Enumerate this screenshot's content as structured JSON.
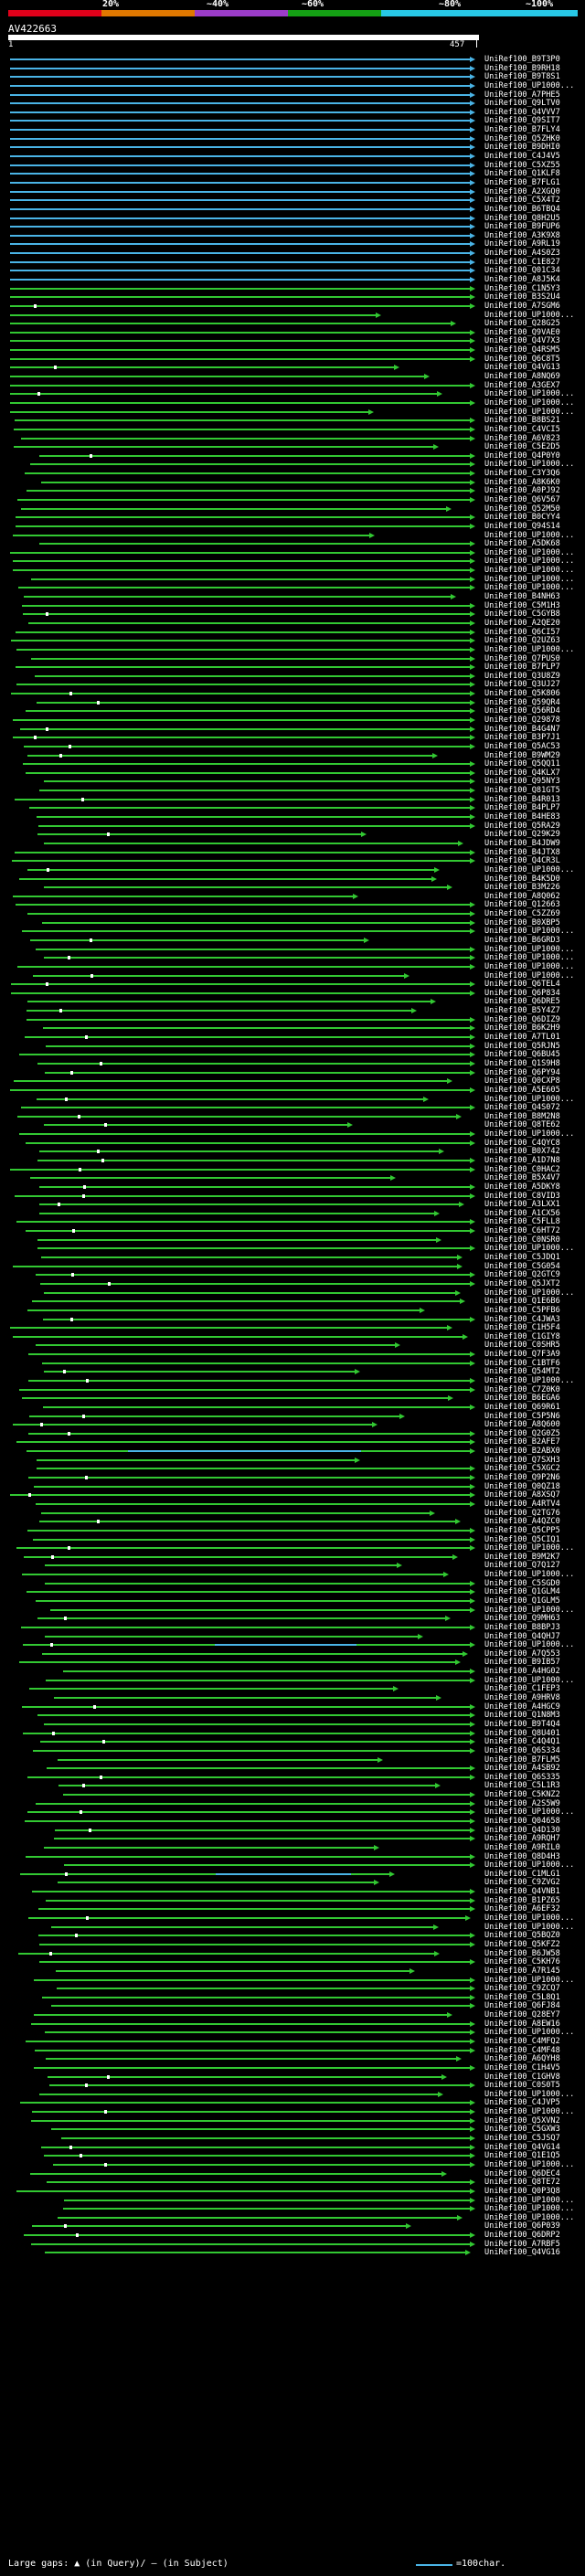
{
  "header": {
    "query_id": "AV422663",
    "query_start": "1",
    "query_end": "457",
    "scale": [
      {
        "label": "20%",
        "color": "#e0001a"
      },
      {
        "label": "~40%",
        "color": "#e07800"
      },
      {
        "label": "~60%",
        "color": "#9b3cc8"
      },
      {
        "label": "~80%",
        "color": "#14a014"
      },
      {
        "label": "~100%",
        "color": "#28c8e6"
      }
    ]
  },
  "hit_colors": {
    "blue": "#4ab4e6",
    "green": "#32c832"
  },
  "hits": [
    "UniRef100_B9T3P0",
    "UniRef100_B9RH18",
    "UniRef100_B9T8S1",
    "UniRef100_UP1000...",
    "UniRef100_A7PHE5",
    "UniRef100_Q9LTV0",
    "UniRef100_Q4VVV7",
    "UniRef100_Q9SIT7",
    "UniRef100_B7FLY4",
    "UniRef100_Q5ZHK0",
    "UniRef100_B9DHI0",
    "UniRef100_C4J4V5",
    "UniRef100_C5XZ55",
    "UniRef100_Q1KLF8",
    "UniRef100_B7FLG1",
    "UniRef100_A2XGQ0",
    "UniRef100_C5X4T2",
    "UniRef100_B6TBQ4",
    "UniRef100_Q8H2U5",
    "UniRef100_B9FUP6",
    "UniRef100_A3K9X8",
    "UniRef100_A9RL19",
    "UniRef100_A4S0Z3",
    "UniRef100_C1E827",
    "UniRef100_Q01C34",
    "UniRef100_A8J5K4",
    "UniRef100_C1N5Y3",
    "UniRef100_B3S2U4",
    "UniRef100_A7SGM6",
    "UniRef100_UP1000...",
    "UniRef100_Q28G25",
    "UniRef100_Q9VAE0",
    "UniRef100_Q4V7X3",
    "UniRef100_Q4RSM5",
    "UniRef100_Q6C8T5",
    "UniRef100_Q4VG13",
    "UniRef100_A8NQ69",
    "UniRef100_A3GEX7",
    "UniRef100_UP1000...",
    "UniRef100_UP1000...",
    "UniRef100_UP1000...",
    "UniRef100_B8BS21",
    "UniRef100_C4VCI5",
    "UniRef100_A6V823",
    "UniRef100_C5E2D5",
    "UniRef100_Q4P0Y0",
    "UniRef100_UP1000...",
    "UniRef100_C3Y3Q6",
    "UniRef100_A8K6K0",
    "UniRef100_A0PJ92",
    "UniRef100_Q6V567",
    "UniRef100_Q52M50",
    "UniRef100_B0CYY4",
    "UniRef100_Q94S14",
    "UniRef100_UP1000...",
    "UniRef100_A5DK68",
    "UniRef100_UP1000...",
    "UniRef100_UP1000...",
    "UniRef100_UP1000...",
    "UniRef100_UP1000...",
    "UniRef100_UP1000...",
    "UniRef100_B4NH63",
    "UniRef100_C5M1H3",
    "UniRef100_C5GYB8",
    "UniRef100_A2QE20",
    "UniRef100_Q6CI57",
    "UniRef100_Q2UZ63",
    "UniRef100_UP1000...",
    "UniRef100_Q7PUS0",
    "UniRef100_B7PLP7",
    "UniRef100_Q3U8Z9",
    "UniRef100_Q3UJ27",
    "UniRef100_Q5K806",
    "UniRef100_Q59QR4",
    "UniRef100_Q56RD4",
    "UniRef100_Q29878",
    "UniRef100_B4G4N7",
    "UniRef100_B3P7J1",
    "UniRef100_Q5AC53",
    "UniRef100_B9WM29",
    "UniRef100_Q5QQ11",
    "UniRef100_Q4KLX7",
    "UniRef100_Q95NY3",
    "UniRef100_Q81GT5",
    "UniRef100_B4R013",
    "UniRef100_B4PLP7",
    "UniRef100_B4HE83",
    "UniRef100_Q5RA29",
    "UniRef100_Q29K29",
    "UniRef100_B4JDW9",
    "UniRef100_B4JTX8",
    "UniRef100_Q4CR3L",
    "UniRef100_UP1000...",
    "UniRef100_B4K5D0",
    "UniRef100_B3M226",
    "UniRef100_A8Q062",
    "UniRef100_Q12663",
    "UniRef100_C5ZZ69",
    "UniRef100_B0XBP5",
    "UniRef100_UP1000...",
    "UniRef100_B6GRD3",
    "UniRef100_UP1000...",
    "UniRef100_UP1000...",
    "UniRef100_UP1000...",
    "UniRef100_UP1000...",
    "UniRef100_Q6TEL4",
    "UniRef100_Q6P834",
    "UniRef100_Q6DRE5",
    "UniRef100_B5Y4Z7",
    "UniRef100_Q6DIZ9",
    "UniRef100_B6K2H9",
    "UniRef100_A7TL01",
    "UniRef100_Q5RJN5",
    "UniRef100_Q6BU45",
    "UniRef100_Q1S9H8",
    "UniRef100_Q6PY94",
    "UniRef100_Q0CXP8",
    "UniRef100_A5E605",
    "UniRef100_UP1000...",
    "UniRef100_Q4S072",
    "UniRef100_B8M2N8",
    "UniRef100_Q8TE62",
    "UniRef100_UP1000...",
    "UniRef100_C4QYC8",
    "UniRef100_B0X742",
    "UniRef100_A1D7N8",
    "UniRef100_C0HAC2",
    "UniRef100_B5X4V7",
    "UniRef100_A5DKY8",
    "UniRef100_C8VID3",
    "UniRef100_A3LXX1",
    "UniRef100_A1CX56",
    "UniRef100_C5FLL8",
    "UniRef100_C6HT72",
    "UniRef100_C0NSR0",
    "UniRef100_UP1000...",
    "UniRef100_C5JDQ1",
    "UniRef100_C5G054",
    "UniRef100_Q2GTC9",
    "UniRef100_Q5JXT2",
    "UniRef100_UP1000...",
    "UniRef100_Q1E6B6",
    "UniRef100_C5PFB6",
    "UniRef100_C4JWA3",
    "UniRef100_C1H5F4",
    "UniRef100_C1GIY8",
    "UniRef100_C0SHR5",
    "UniRef100_Q7F3A9",
    "UniRef100_C1BTF6",
    "UniRef100_Q54MT2",
    "UniRef100_UP1000...",
    "UniRef100_C7Z0K0",
    "UniRef100_B6EGA6",
    "UniRef100_Q69R61",
    "UniRef100_C5P5N6",
    "UniRef100_A8Q600",
    "UniRef100_Q2G0Z5",
    "UniRef100_B2AFE7",
    "UniRef100_B2ABX0",
    "UniRef100_Q7SXH3",
    "UniRef100_C5XGC2",
    "UniRef100_Q9P2N6",
    "UniRef100_Q0QZ18",
    "UniRef100_A8XSQ7",
    "UniRef100_A4RTV4",
    "UniRef100_Q2TG76",
    "UniRef100_A4QZC0",
    "UniRef100_Q5CPP5",
    "UniRef100_Q5CIQ1",
    "UniRef100_UP1000...",
    "UniRef100_B9M2K7",
    "UniRef100_Q7Q127",
    "UniRef100_UP1000...",
    "UniRef100_C5SGD0",
    "UniRef100_Q1GLM4",
    "UniRef100_Q1GLM5",
    "UniRef100_UP1000...",
    "UniRef100_Q9MH63",
    "UniRef100_B8BPJ3",
    "UniRef100_Q4QHJ7",
    "UniRef100_UP1000...",
    "UniRef100_A7Q553",
    "UniRef100_B9IB57",
    "UniRef100_A4HG02",
    "UniRef100_UP1000...",
    "UniRef100_C1FEP3",
    "UniRef100_A9HRV8",
    "UniRef100_A4HGC9",
    "UniRef100_Q1N8M3",
    "UniRef100_B9T4Q4",
    "UniRef100_Q8U401",
    "UniRef100_C4Q4Q1",
    "UniRef100_Q6S334",
    "UniRef100_B7FLM5",
    "UniRef100_A4SB92",
    "UniRef100_Q6S335",
    "UniRef100_C5L1R3",
    "UniRef100_C5KNZ2",
    "UniRef100_A2S5W9",
    "UniRef100_UP1000...",
    "UniRef100_Q04658",
    "UniRef100_Q4D130",
    "UniRef100_A9RQH7",
    "UniRef100_A9RIL0",
    "UniRef100_Q8D4H3",
    "UniRef100_UP1000...",
    "UniRef100_C1MLG1",
    "UniRef100_C9ZVG2",
    "UniRef100_Q4VNB1",
    "UniRef100_B1PZ65",
    "UniRef100_A6EF32",
    "UniRef100_UP1000...",
    "UniRef100_UP1000...",
    "UniRef100_Q5BQZ0",
    "UniRef100_Q5KFZ2",
    "UniRef100_B6JW58",
    "UniRef100_C5KH76",
    "UniRef100_A7R145",
    "UniRef100_UP1000...",
    "UniRef100_C9ZCQ7",
    "UniRef100_C5L8Q1",
    "UniRef100_Q6FJ84",
    "UniRef100_Q28EY7",
    "UniRef100_A8EW16",
    "UniRef100_UP1000...",
    "UniRef100_C4MFQ2",
    "UniRef100_C4MF48",
    "UniRef100_A6QYH8",
    "UniRef100_C1H4V5",
    "UniRef100_C1GHV8",
    "UniRef100_C0S0T5",
    "UniRef100_UP1000...",
    "UniRef100_C4JVP5",
    "UniRef100_UP1000...",
    "UniRef100_Q5XVN2",
    "UniRef100_C5GXW3",
    "UniRef100_C5JSQ7",
    "UniRef100_Q4VG14",
    "UniRef100_Q1E1Q5",
    "UniRef100_UP1000...",
    "UniRef100_Q6DEC4",
    "UniRef100_Q8TE72",
    "UniRef100_Q0P3Q8",
    "UniRef100_UP1000...",
    "UniRef100_UP1000...",
    "UniRef100_UP1000...",
    "UniRef100_Q6P039",
    "UniRef100_Q6DRP2",
    "UniRef100_A7RBF5",
    "UniRef100_Q4VG16"
  ],
  "legend": {
    "text": "Large gaps: ▲ (in Query)/ — (in Subject)",
    "scale_text": "=100char.",
    "color": "#4ab4e6"
  }
}
